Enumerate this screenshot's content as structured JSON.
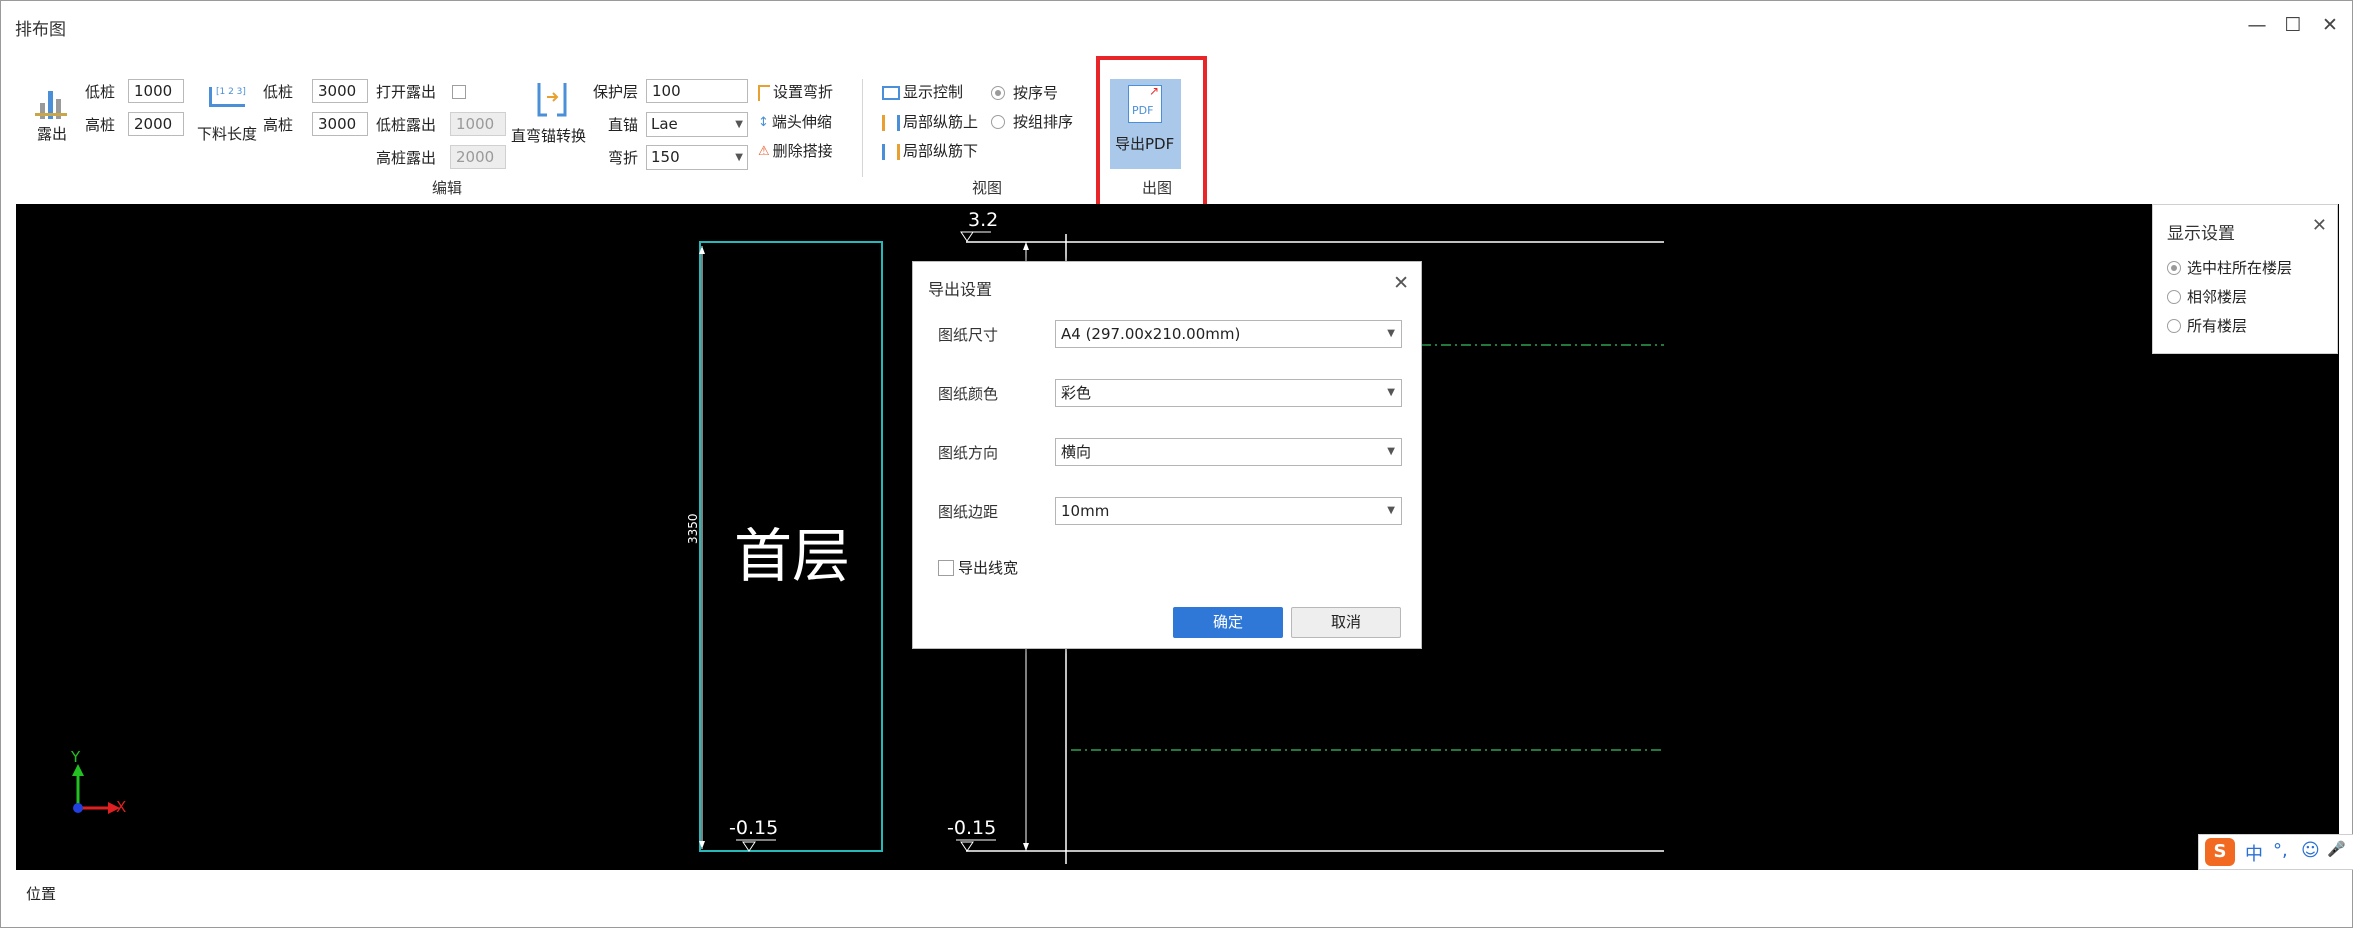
{
  "window": {
    "title": "排布图",
    "minimize": "—",
    "maximize": "☐",
    "close": "✕"
  },
  "ribbon": {
    "expose": {
      "label": "露出",
      "low_pile_label": "低桩",
      "low_pile_value": "1000",
      "high_pile_label": "高桩",
      "high_pile_value": "2000"
    },
    "cut_length": {
      "label": "下料长度",
      "icon_text": "[1 2 3]",
      "low_pile_label": "低桩",
      "low_pile_value": "3000",
      "high_pile_label": "高桩",
      "high_pile_value": "3000"
    },
    "open_expose": {
      "label": "打开露出",
      "low_label": "低桩露出",
      "low_value": "1000",
      "high_label": "高桩露出",
      "high_value": "2000"
    },
    "convert": {
      "label": "直弯锚转换"
    },
    "cover": {
      "label": "保护层",
      "value": "100"
    },
    "straight": {
      "label": "直锚",
      "value": "Lae"
    },
    "bend": {
      "label": "弯折",
      "value": "150"
    },
    "actions": [
      "设置弯折",
      "端头伸缩",
      "删除搭接"
    ],
    "edit_group": "编辑",
    "view": {
      "display_control": "显示控制",
      "local_up": "局部纵筋上",
      "local_down": "局部纵筋下",
      "by_order": "按序号",
      "by_group": "按组排序"
    },
    "view_group": "视图",
    "export_pdf": {
      "label": "导出PDF",
      "icon_text": "PDF"
    },
    "output_group": "出图"
  },
  "canvas": {
    "floor_name": "首层",
    "dim_text": "3350",
    "elev_top": "3.2",
    "elev_bottom_left": "-0.15",
    "elev_bottom_right": "-0.15",
    "axis_x": "X",
    "axis_y": "Y",
    "colors": {
      "column": "#27b9b9",
      "line": "#ffffff",
      "dashed": "#2f9f4f",
      "axis_x": "#e02020",
      "axis_y": "#22c022"
    }
  },
  "status": {
    "label": "位置"
  },
  "display_panel": {
    "title": "显示设置",
    "options": [
      "选中柱所在楼层",
      "相邻楼层",
      "所有楼层"
    ],
    "selected": 0
  },
  "dialog": {
    "title": "导出设置",
    "fields": [
      {
        "label": "图纸尺寸",
        "value": "A4 (297.00x210.00mm)"
      },
      {
        "label": "图纸颜色",
        "value": "彩色"
      },
      {
        "label": "图纸方向",
        "value": "横向"
      },
      {
        "label": "图纸边距",
        "value": "10mm"
      }
    ],
    "checkbox_label": "导出线宽",
    "ok": "确定",
    "cancel": "取消"
  },
  "ime": {
    "logo": "S",
    "mode": "中",
    "punct": "°,",
    "emoji": "☺",
    "voice": "🎤"
  }
}
